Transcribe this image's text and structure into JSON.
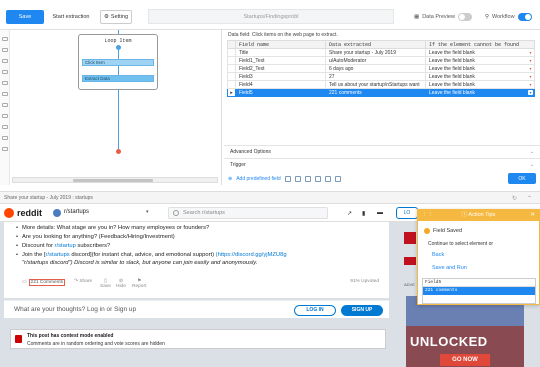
{
  "toolbar": {
    "save_label": "Save",
    "start_label": "Start extraction",
    "setting_label": "Setting",
    "task_title": "Startups/Findingsprobl",
    "data_preview_label": "Data Preview",
    "workflow_label": "Workflow"
  },
  "workflow": {
    "loop_title": "Loop Item",
    "items": [
      {
        "label": "Click Item",
        "selected": false
      },
      {
        "label": "Extract Data",
        "selected": true
      }
    ]
  },
  "datapane": {
    "hint": "Data field: Click items on the web page to extract.",
    "columns": [
      "Field name",
      "Data extracted",
      "If the element cannot be found"
    ],
    "rows": [
      {
        "field": "Title",
        "data": "Share your startup - July 2019",
        "action": "Leave the field blank"
      },
      {
        "field": "Field1_Text",
        "data": "u/AutoModerator",
        "action": "Leave the field blank"
      },
      {
        "field": "Field2_Text",
        "data": "6 days ago",
        "action": "Leave the field blank"
      },
      {
        "field": "Field3",
        "data": "27",
        "action": "Leave the field blank"
      },
      {
        "field": "Field4",
        "data": "Tell us about your startup\\nStartups want",
        "action": "Leave the field blank"
      },
      {
        "field": "Field5",
        "data": "221 comments",
        "action": "Leave the field blank"
      }
    ],
    "selected_row": 5,
    "advanced_label": "Advanced Options",
    "trigger_label": "Trigger",
    "add_field_label": "Add predefined field",
    "ok_label": "OK"
  },
  "addressbar": {
    "text": "Share your startup - July 2019 : startups"
  },
  "reddit": {
    "logo_text": "reddit",
    "subreddit": "r/startups",
    "search_placeholder": "Search r/startups",
    "login_short": "LO",
    "bullets": [
      {
        "text": "More details: What stage are you in? How many employees or founders?"
      },
      {
        "text": "Are you looking for anything? (Feedback/Hiring/Investment)"
      },
      {
        "pre": "Discount for ",
        "link": "r/startup",
        "post": " subscribers?"
      },
      {
        "pre": "Join the [",
        "link": "r/startups",
        "mid": " discord](for instant chat, advice, and emotional support) ",
        "link2": "(https://discord.gg/yjMZU8g",
        "line2": " \"r/startups discord\") Discord is similar to slack, but anyone can join easily and anonymously."
      }
    ],
    "actions": {
      "comments": "221 Comments",
      "share": "Share",
      "save": "Save",
      "hide": "Hide",
      "report": "Report",
      "upvoted": "91% Upvoted"
    },
    "login_prompt": "What are your thoughts? Log in or Sign up",
    "login_btn": "LOG IN",
    "signup_btn": "SIGN UP",
    "archived_title": "This post has contest mode enabled",
    "archived_text": "Comments are in random ordering and vote scores are hidden",
    "ad_label": "ADVE",
    "ad_headline": "UNLOCKED",
    "ad_cta": "GO NOW"
  },
  "tips": {
    "title": "Action Tips",
    "field_saved": "Field Saved",
    "continue": "Continue to select element or",
    "back": "Back",
    "save_run": "Save and Run",
    "preview_header": "Field5",
    "preview_value": "221 comments"
  },
  "colors": {
    "accent": "#1e87f0",
    "reddit_orange": "#ff4500",
    "tips_header": "#f5b942"
  }
}
